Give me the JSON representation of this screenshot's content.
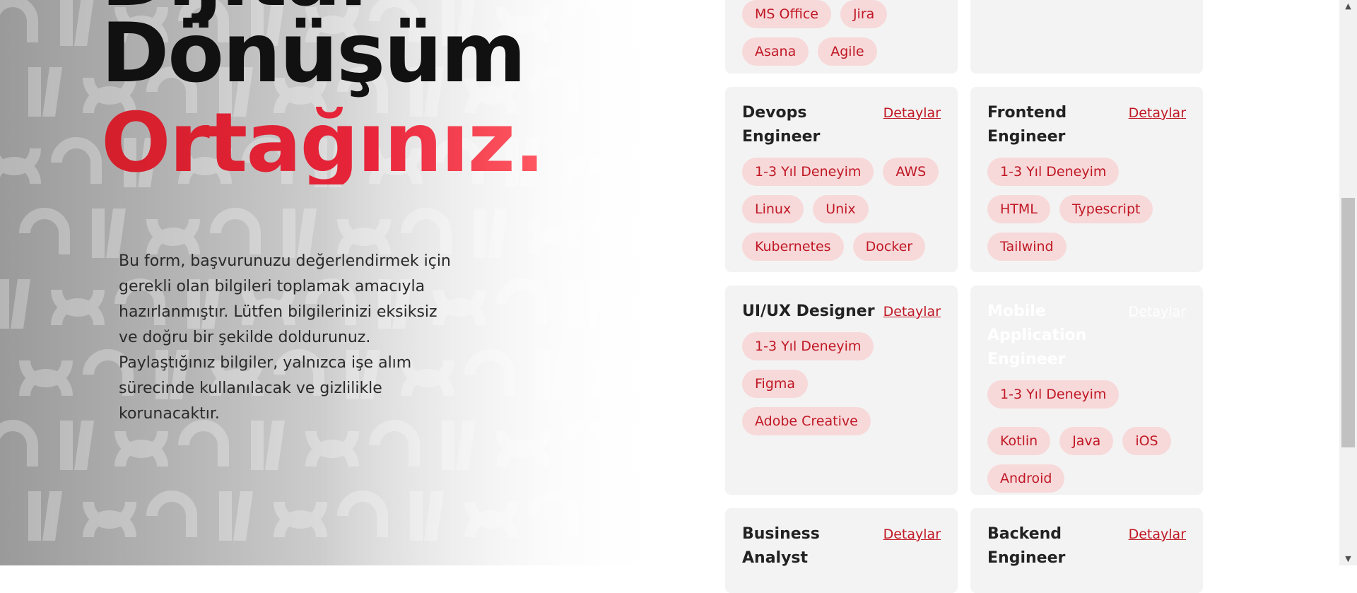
{
  "hero": {
    "title_line1": "Dijital",
    "title_line2": "Dönüşüm",
    "title_line3": "Ortağınız.",
    "description": "Bu form, başvurunuzu değerlendirmek için gerekli olan bilgileri toplamak amacıyla hazırlanmıştır. Lütfen bilgilerinizi eksiksiz ve doğru bir şekilde doldurunuz. Paylaştığınız bilgiler, yalnızca işe alım sürecinde kullanılacak ve gizlilikle korunacaktır."
  },
  "cards": [
    {
      "title": "",
      "link": "",
      "tags": [
        "MS Office",
        "Jira",
        "Asana",
        "Agile"
      ]
    },
    {
      "title": "",
      "link": "",
      "tags": []
    },
    {
      "title": "Devops Engineer",
      "link": "Detaylar",
      "tags": [
        "1-3 Yıl Deneyim",
        "AWS",
        "Linux",
        "Unix",
        "Kubernetes",
        "Docker"
      ]
    },
    {
      "title": "Frontend Engineer",
      "link": "Detaylar",
      "tags": [
        "1-3 Yıl Deneyim",
        "HTML",
        "Typescript",
        "Tailwind"
      ]
    },
    {
      "title": "UI/UX Designer",
      "link": "Detaylar",
      "tags": [
        "1-3 Yıl Deneyim",
        "Figma",
        "Adobe Creative"
      ]
    },
    {
      "title": "Mobile Application Engineer",
      "link": "Detaylar",
      "tags": [
        "1-3 Yıl Deneyim",
        "Kotlin",
        "Java",
        "iOS",
        "Android"
      ]
    },
    {
      "title": "Business Analyst",
      "link": "Detaylar",
      "tags": []
    },
    {
      "title": "Backend Engineer",
      "link": "Detaylar",
      "tags": []
    }
  ],
  "colors": {
    "accent": "#c01824",
    "tag_bg": "#f7d9da",
    "card_bg": "#f4f3f3",
    "title_red": "#e8243a"
  },
  "scrollbar": {
    "up_icon": "arrow-up-icon",
    "down_icon": "arrow-down-icon"
  }
}
